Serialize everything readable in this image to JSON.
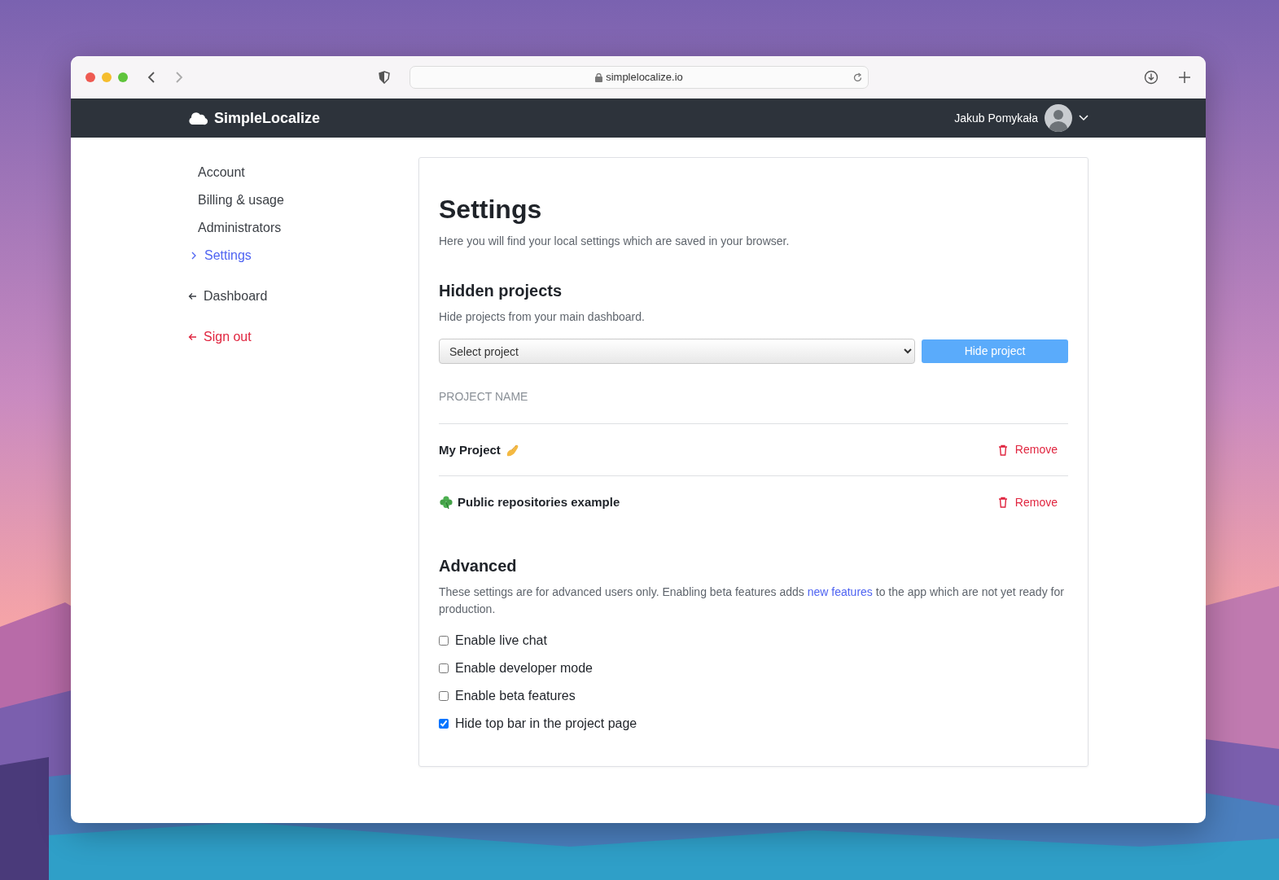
{
  "browser": {
    "url": "simplelocalize.io"
  },
  "navbar": {
    "brand": "SimpleLocalize",
    "user": "Jakub Pomykała"
  },
  "sidebar": {
    "items": [
      {
        "label": "Account",
        "kind": "link",
        "selected": false
      },
      {
        "label": "Billing & usage",
        "kind": "link",
        "selected": false
      },
      {
        "label": "Administrators",
        "kind": "link",
        "selected": false
      },
      {
        "label": "Settings",
        "kind": "link",
        "selected": true
      },
      {
        "label": "Dashboard",
        "kind": "back",
        "selected": false
      },
      {
        "label": "Sign out",
        "kind": "signout",
        "selected": false
      }
    ]
  },
  "settings": {
    "title": "Settings",
    "subtitle": "Here you will find your local settings which are saved in your browser."
  },
  "hidden_projects": {
    "heading": "Hidden projects",
    "description": "Hide projects from your main dashboard.",
    "select": {
      "value": "Select project"
    },
    "button": "Hide project",
    "column": "PROJECT NAME",
    "rows": [
      {
        "name": "My Project",
        "kind": "hand",
        "remove": "Remove"
      },
      {
        "name": "Public repositories example",
        "kind": "clover",
        "remove": "Remove"
      }
    ]
  },
  "advanced": {
    "heading": "Advanced",
    "description_before": "These settings are for advanced users only. Enabling beta features adds",
    "link": "new features",
    "description_after": "to the app which are not yet ready for production.",
    "options": [
      {
        "label": "Enable live chat",
        "checked": false
      },
      {
        "label": "Enable developer mode",
        "checked": false
      },
      {
        "label": "Enable beta features",
        "checked": false
      },
      {
        "label": "Hide top bar in the project page",
        "checked": true
      }
    ]
  }
}
